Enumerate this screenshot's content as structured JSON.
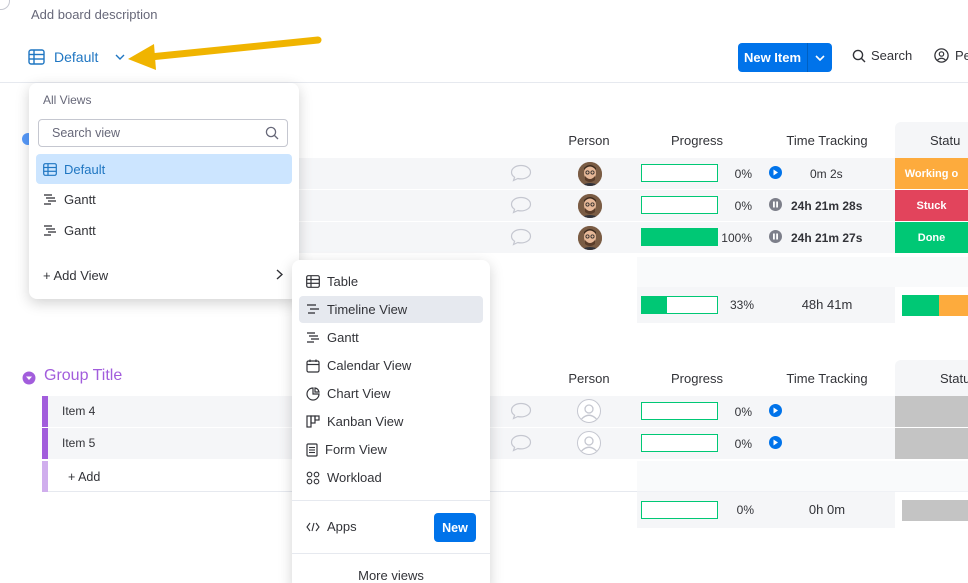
{
  "board": {
    "description_placeholder": "Add board description"
  },
  "view_selector": {
    "label": "Default"
  },
  "toolbar": {
    "new_item_label": "New Item",
    "search_label": "Search",
    "person_label": "Pe"
  },
  "columns": {
    "person": "Person",
    "progress": "Progress",
    "time_tracking": "Time Tracking",
    "status": "Statu"
  },
  "group1": {
    "rows": [
      {
        "progress": 0,
        "progress_label": "0%",
        "time": "0m 2s",
        "timer": "play",
        "status": "Working o",
        "status_color": "#fdab3d"
      },
      {
        "progress": 0,
        "progress_label": "0%",
        "time": "24h 21m 28s",
        "timer": "pause",
        "status": "Stuck",
        "status_color": "#e2445c"
      },
      {
        "progress": 100,
        "progress_label": "100%",
        "time": "24h 21m 27s",
        "timer": "pause",
        "status": "Done",
        "status_color": "#00c875"
      }
    ],
    "summary": {
      "progress": 33,
      "progress_label": "33%",
      "time": "48h 41m"
    }
  },
  "group2": {
    "title": "Group Title",
    "rows": [
      {
        "name": "Item 4",
        "progress": 0,
        "progress_label": "0%"
      },
      {
        "name": "Item 5",
        "progress": 0,
        "progress_label": "0%"
      }
    ],
    "add_label": "+ Add",
    "summary": {
      "progress": 0,
      "progress_label": "0%",
      "time": "0h 0m"
    }
  },
  "views_dropdown": {
    "header": "All Views",
    "search_placeholder": "Search view",
    "items": [
      {
        "label": "Default",
        "icon": "table-icon",
        "active": true
      },
      {
        "label": "Gantt",
        "icon": "gantt-icon",
        "active": false
      },
      {
        "label": "Gantt",
        "icon": "gantt-icon",
        "active": false
      }
    ],
    "add_view_label": "+ Add View"
  },
  "add_view_menu": {
    "items": [
      {
        "label": "Table",
        "icon": "table-icon"
      },
      {
        "label": "Timeline View",
        "icon": "timeline-icon"
      },
      {
        "label": "Gantt",
        "icon": "gantt-icon"
      },
      {
        "label": "Calendar View",
        "icon": "calendar-icon"
      },
      {
        "label": "Chart View",
        "icon": "chart-icon"
      },
      {
        "label": "Kanban View",
        "icon": "kanban-icon"
      },
      {
        "label": "Form View",
        "icon": "form-icon"
      },
      {
        "label": "Workload",
        "icon": "workload-icon"
      }
    ],
    "apps_label": "Apps",
    "new_badge": "New",
    "more_views_label": "More views"
  },
  "colors": {
    "accent": "#0073ea",
    "group_purple": "#a25ddc",
    "progress_green": "#00c875",
    "arrow": "#f0b400"
  }
}
